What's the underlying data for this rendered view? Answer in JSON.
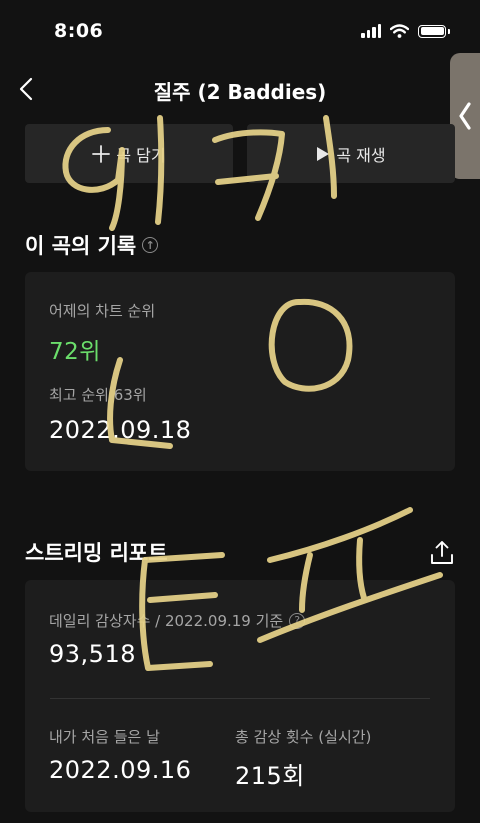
{
  "status_bar": {
    "time": "8:06"
  },
  "nav": {
    "title": "질주 (2 Baddies)"
  },
  "actions": {
    "add_label": "곡 담기",
    "play_label": "곡 재생"
  },
  "record": {
    "title": "이 곡의 기록",
    "yesterday_label": "어제의 차트 순위",
    "yesterday_rank": "72위",
    "best_label": "최고 순위 63위",
    "best_date": "2022.09.18"
  },
  "streaming": {
    "title": "스트리밍 리포트",
    "daily_label": "데일리 감상자수 / 2022.09.19 기준",
    "daily_value": "93,518",
    "first_label": "내가 처음 들은 날",
    "first_date": "2022.09.16",
    "total_label": "총 감상 횟수 (실시간)",
    "total_value": "215회"
  },
  "colors": {
    "background": "#121212",
    "card": "#1d1d1d",
    "rank_green": "#6bde6b",
    "scribble": "#e8d48a"
  }
}
